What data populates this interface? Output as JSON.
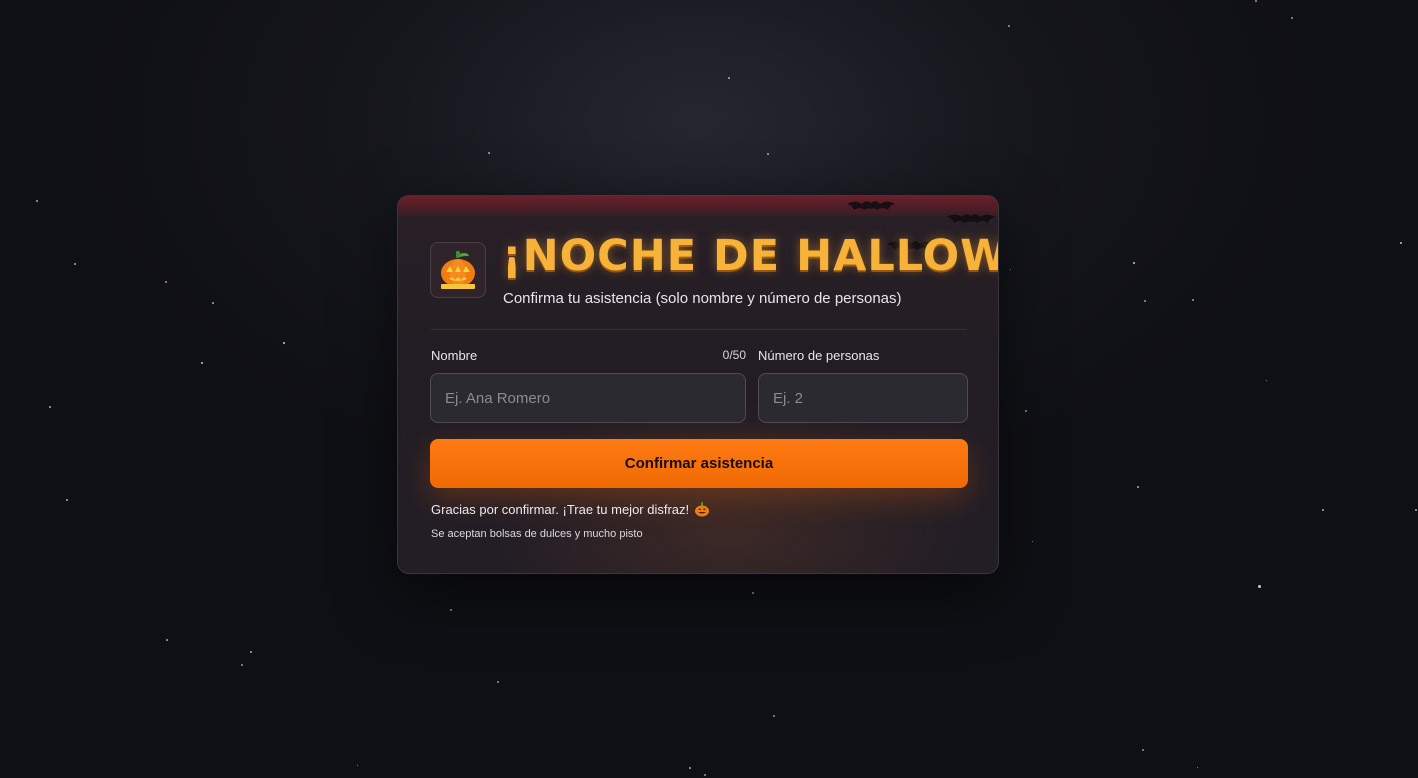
{
  "colors": {
    "accent": "#f06a04",
    "title": "#f7b23a",
    "background": "#15161c",
    "card": "#221e25"
  },
  "header": {
    "icon": "jack-o-lantern-icon",
    "title": "¡NOCHE DE HALLOWEEN!",
    "subtitle": "Confirma tu asistencia (solo nombre y número de personas)"
  },
  "form": {
    "name": {
      "label": "Nombre",
      "counter": "0/50",
      "value": "",
      "placeholder": "Ej. Ana Romero"
    },
    "people": {
      "label": "Número de personas",
      "value": "",
      "placeholder": "Ej. 2"
    },
    "submit_label": "Confirmar asistencia"
  },
  "footer": {
    "thanks": "Gracias por confirmar. ¡Trae tu mejor disfraz!",
    "thanks_icon": "pumpkin-icon",
    "note": "Se aceptan bolsas de dulces y mucho pisto"
  }
}
